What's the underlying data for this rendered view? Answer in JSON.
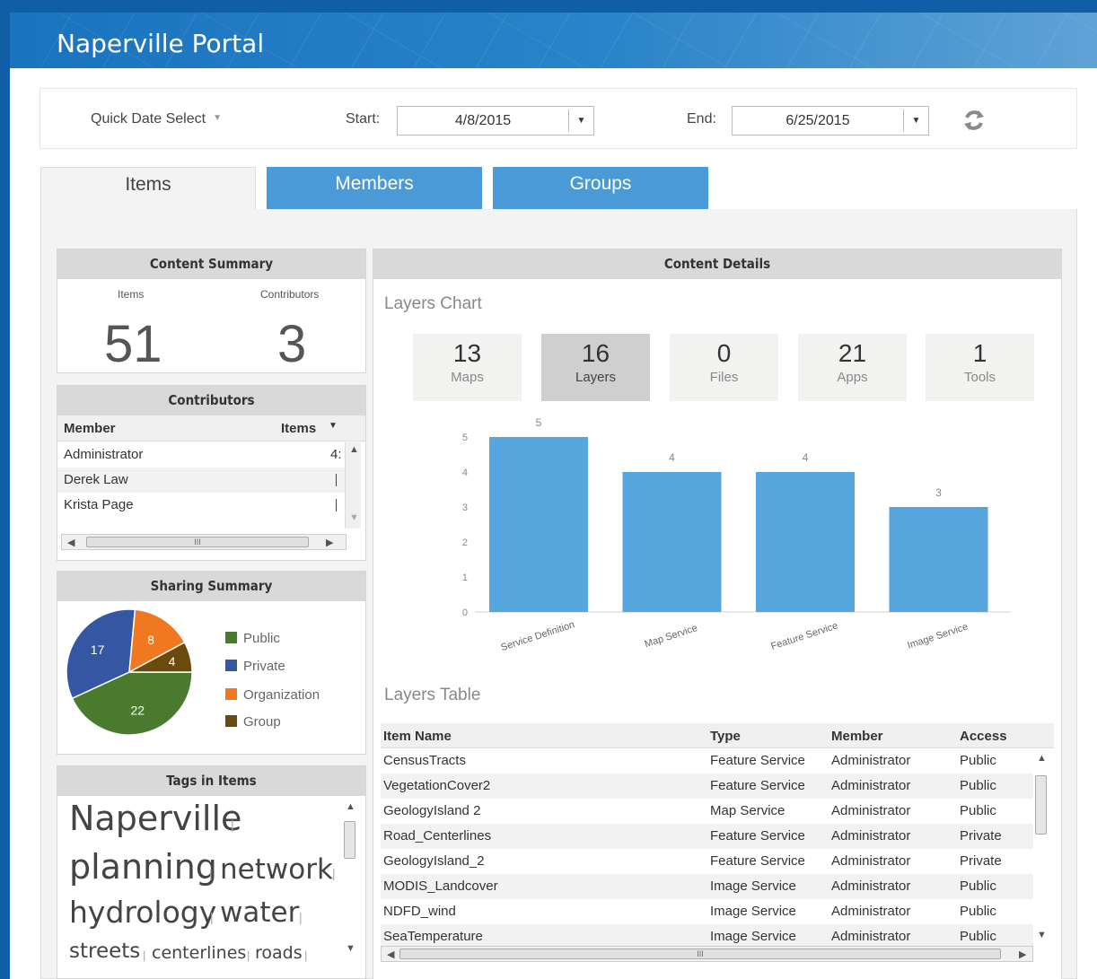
{
  "app": {
    "title": "Naperville Portal"
  },
  "datebar": {
    "quick_label": "Quick Date Select",
    "start_label": "Start:",
    "start_value": "4/8/2015",
    "end_label": "End:",
    "end_value": "6/25/2015"
  },
  "tabs": [
    {
      "label": "Items",
      "active": true
    },
    {
      "label": "Members",
      "active": false
    },
    {
      "label": "Groups",
      "active": false
    }
  ],
  "content_summary": {
    "title": "Content Summary",
    "items_label": "Items",
    "items_value": "51",
    "contributors_label": "Contributors",
    "contributors_value": "3"
  },
  "contributors": {
    "title": "Contributors",
    "col_member": "Member",
    "col_items": "Items",
    "rows": [
      {
        "member": "Administrator",
        "items": "4:"
      },
      {
        "member": "Derek Law",
        "items": ""
      },
      {
        "member": "Krista Page",
        "items": ""
      }
    ],
    "scroll_grip": "III"
  },
  "sharing_summary": {
    "title": "Sharing Summary",
    "slices": [
      {
        "name": "Public",
        "value": 22,
        "color": "#4a7a2e"
      },
      {
        "name": "Private",
        "value": 17,
        "color": "#3556a3"
      },
      {
        "name": "Organization",
        "value": 8,
        "color": "#f07820"
      },
      {
        "name": "Group",
        "value": 4,
        "color": "#6b4a0e"
      }
    ]
  },
  "tags": {
    "title": "Tags in Items",
    "words": [
      "Naperville",
      "planning",
      "network",
      "hydrology",
      "water",
      "streets",
      "centerlines",
      "roads"
    ]
  },
  "content_details": {
    "title": "Content Details",
    "chart_title": "Layers Chart",
    "tiles": [
      {
        "value": "13",
        "label": "Maps"
      },
      {
        "value": "16",
        "label": "Layers"
      },
      {
        "value": "0",
        "label": "Files"
      },
      {
        "value": "21",
        "label": "Apps"
      },
      {
        "value": "1",
        "label": "Tools"
      }
    ],
    "table_title": "Layers Table",
    "columns": [
      "Item Name",
      "Type",
      "Member",
      "Access"
    ],
    "rows": [
      [
        "CensusTracts",
        "Feature Service",
        "Administrator",
        "Public"
      ],
      [
        "VegetationCover2",
        "Feature Service",
        "Administrator",
        "Public"
      ],
      [
        "GeologyIsland 2",
        "Map Service",
        "Administrator",
        "Public"
      ],
      [
        "Road_Centerlines",
        "Feature Service",
        "Administrator",
        "Private"
      ],
      [
        "GeologyIsland_2",
        "Feature Service",
        "Administrator",
        "Private"
      ],
      [
        "MODIS_Landcover",
        "Image Service",
        "Administrator",
        "Public"
      ],
      [
        "NDFD_wind",
        "Image Service",
        "Administrator",
        "Public"
      ],
      [
        "SeaTemperature",
        "Image Service",
        "Administrator",
        "Public"
      ]
    ],
    "scroll_grip": "III"
  },
  "colors": {
    "header": "#1a73bd",
    "tab_inactive": "#4a9ad8",
    "bar": "#56a5dc"
  },
  "chart_data": {
    "type": "bar",
    "categories": [
      "Service Definition",
      "Map Service",
      "Feature Service",
      "Image Service"
    ],
    "values": [
      5,
      4,
      4,
      3
    ],
    "title": "",
    "xlabel": "",
    "ylabel": "",
    "ylim": [
      0,
      5
    ],
    "yticks": [
      0,
      1,
      2,
      3,
      4,
      5
    ],
    "grid": false,
    "data_labels": true
  }
}
